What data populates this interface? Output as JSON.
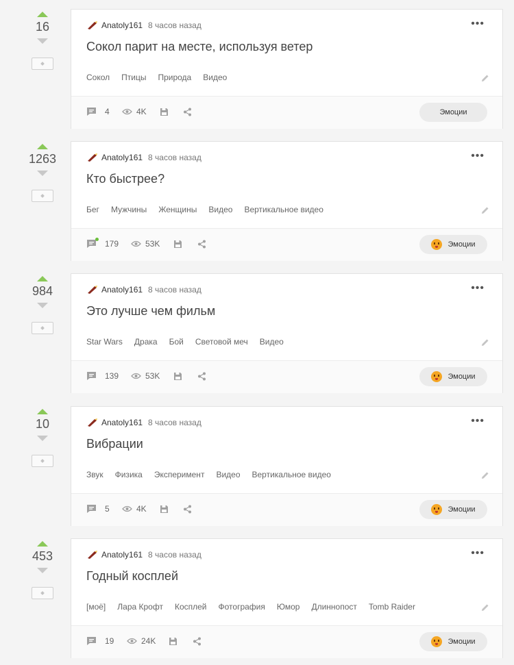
{
  "posts": [
    {
      "score": "16",
      "author": "Anatoly161",
      "time": "8 часов назад",
      "title": "Сокол парит на месте, используя ветер",
      "tags": [
        "Сокол",
        "Птицы",
        "Природа",
        "Видео"
      ],
      "comments": "4",
      "views": "4K",
      "emotions_label": "Эмоции",
      "has_emotion_icon": false,
      "new_comments": false
    },
    {
      "score": "1263",
      "author": "Anatoly161",
      "time": "8 часов назад",
      "title": "Кто быстрее?",
      "tags": [
        "Бег",
        "Мужчины",
        "Женщины",
        "Видео",
        "Вертикальное видео"
      ],
      "comments": "179",
      "views": "53K",
      "emotions_label": "Эмоции",
      "has_emotion_icon": true,
      "new_comments": true
    },
    {
      "score": "984",
      "author": "Anatoly161",
      "time": "8 часов назад",
      "title": "Это лучше чем фильм",
      "tags": [
        "Star Wars",
        "Драка",
        "Бой",
        "Световой меч",
        "Видео"
      ],
      "comments": "139",
      "views": "53K",
      "emotions_label": "Эмоции",
      "has_emotion_icon": true,
      "new_comments": false
    },
    {
      "score": "10",
      "author": "Anatoly161",
      "time": "8 часов назад",
      "title": "Вибрации",
      "tags": [
        "Звук",
        "Физика",
        "Эксперимент",
        "Видео",
        "Вертикальное видео"
      ],
      "comments": "5",
      "views": "4K",
      "emotions_label": "Эмоции",
      "has_emotion_icon": true,
      "new_comments": false
    },
    {
      "score": "453",
      "author": "Anatoly161",
      "time": "8 часов назад",
      "title": "Годный косплей",
      "tags": [
        "[моё]",
        "Лара Крофт",
        "Косплей",
        "Фотография",
        "Юмор",
        "Длиннопост",
        "Tomb Raider"
      ],
      "comments": "19",
      "views": "24K",
      "emotions_label": "Эмоции",
      "has_emotion_icon": true,
      "new_comments": false
    }
  ],
  "icons": {
    "vote_up": "arrow-up-icon",
    "vote_down": "arrow-down-icon",
    "save": "bookmark-icon",
    "more": "more-icon",
    "edit": "pencil-icon",
    "comments": "comment-icon",
    "views": "eye-icon",
    "disk": "floppy-icon",
    "share": "share-icon"
  },
  "colors": {
    "upvote": "#8ac858",
    "downvote": "#c8c8c8",
    "background": "#f4f4f4",
    "card": "#ffffff",
    "emotion_button": "#ebebeb"
  }
}
